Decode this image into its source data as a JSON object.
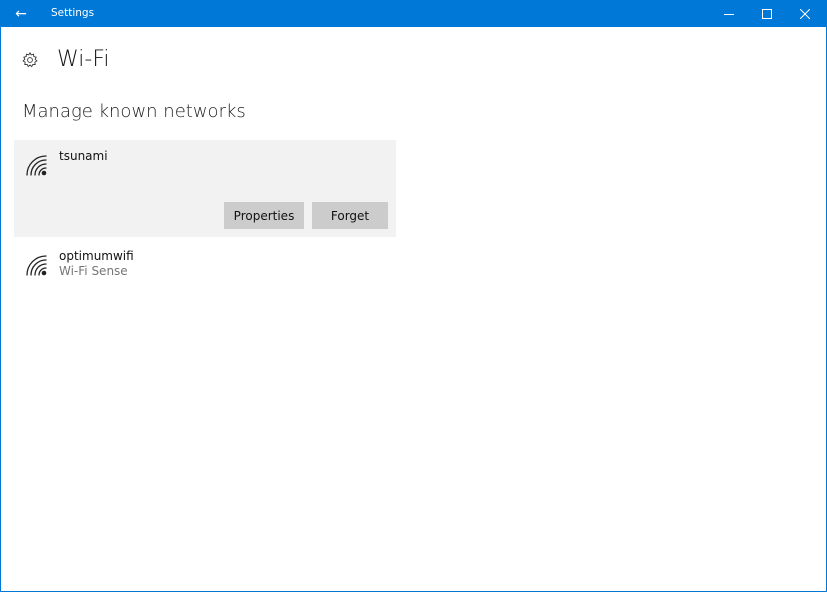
{
  "titlebar": {
    "app_title": "Settings",
    "back_icon": "←"
  },
  "header": {
    "title": "Wi-Fi"
  },
  "section": {
    "title": "Manage known networks"
  },
  "networks": [
    {
      "name": "tsunami",
      "subtitle": "",
      "selected": true,
      "properties_label": "Properties",
      "forget_label": "Forget"
    },
    {
      "name": "optimumwifi",
      "subtitle": "Wi-Fi Sense",
      "selected": false
    }
  ],
  "colors": {
    "accent": "#0078d7",
    "selected_bg": "#f2f2f2",
    "button_bg": "#cccccc",
    "secondary_text": "#767676"
  }
}
